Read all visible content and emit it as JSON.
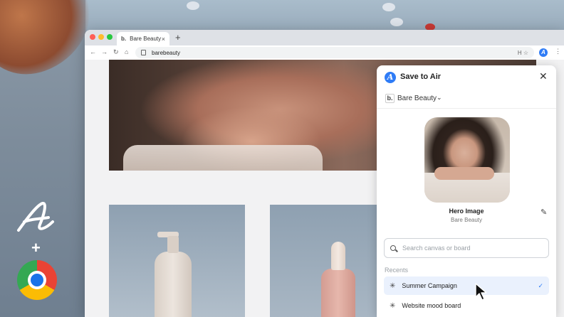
{
  "brand": {
    "plus": "+"
  },
  "browser": {
    "tab_title": "Bare Beauty",
    "tab_favicon": "b.",
    "tab_close": "×",
    "new_tab": "+",
    "url": "barebeauty",
    "omnibox_right": "H ☆",
    "extension_glyph": "A",
    "kebab": "⋮",
    "nav": {
      "back": "←",
      "forward": "→",
      "reload": "↻",
      "home": "⌂"
    },
    "traffic_colors": [
      "#ff5f57",
      "#febc2e",
      "#28c840"
    ]
  },
  "panel": {
    "title": "Save to Air",
    "logo_glyph": "A",
    "close": "✕",
    "workspace_icon": "b.",
    "workspace": "Bare Beauty",
    "workspace_caret": "⌄",
    "asset_name": "Hero Image",
    "asset_source": "Bare Beauty",
    "edit": "✎",
    "search_placeholder": "Search canvas or board",
    "recents_label": "Recents",
    "items": [
      {
        "label": "Summer Campaign",
        "icon": "✳",
        "selected": true,
        "check": "✓"
      },
      {
        "label": "Website mood board",
        "icon": "✳",
        "selected": false,
        "check": ""
      }
    ]
  },
  "colors": {
    "accent": "#2f7cf6",
    "selected_row": "#eaf1fd"
  }
}
